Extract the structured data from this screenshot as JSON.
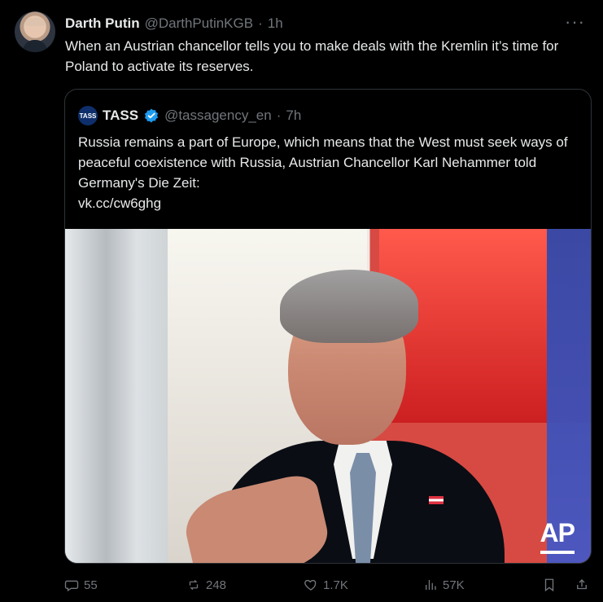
{
  "tweet": {
    "author_name": "Darth Putin",
    "author_handle": "@DarthPutinKGB",
    "separator": "·",
    "time": "1h",
    "more_menu": "···",
    "text": "When an Austrian chancellor tells you to make deals with the Kremlin it’s time for Poland to activate its reserves."
  },
  "quoted_tweet": {
    "logo_text": "TASS",
    "author_name": "TASS",
    "author_handle": "@tassagency_en",
    "separator": "·",
    "time": "7h",
    "text": "Russia remains a part of Europe, which means that the West must seek ways of peaceful coexistence with Russia, Austrian Chancellor Karl Nehammer told Germany's Die Zeit:",
    "link": "vk.cc/cw6ghg",
    "photo_credit": "AP"
  },
  "actions": {
    "replies": "55",
    "reposts": "248",
    "likes": "1.7K",
    "views": "57K"
  },
  "icons": {
    "reply": "reply-icon",
    "repost": "repost-icon",
    "like": "heart-icon",
    "views": "views-icon",
    "bookmark": "bookmark-icon",
    "share": "share-icon",
    "verified": "verified-badge-icon"
  },
  "colors": {
    "background": "#000000",
    "text": "#e7e9ea",
    "muted": "#71767b",
    "border": "#2f3336",
    "verified": "#1d9bf0"
  }
}
